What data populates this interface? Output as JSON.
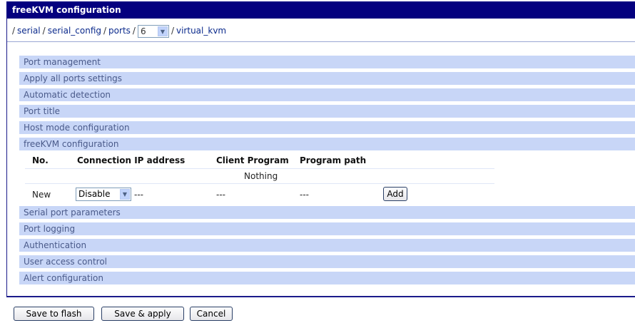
{
  "window": {
    "title": "freeKVM configuration"
  },
  "breadcrumb": {
    "lead_sep": "/",
    "items": [
      "serial",
      "serial_config",
      "ports"
    ],
    "seps": [
      "/",
      "/",
      "/",
      "/"
    ],
    "port_select_value": "6",
    "last": "virtual_kvm"
  },
  "sections_top": [
    "Port management",
    "Apply all ports settings",
    "Automatic detection",
    "Port title",
    "Host mode configuration",
    "freeKVM configuration"
  ],
  "kvm_table": {
    "headers": [
      "No.",
      "Connection IP address",
      "Client Program",
      "Program path"
    ],
    "empty_text": "Nothing",
    "new_row": {
      "no": "New",
      "select_value": "Disable",
      "ip": "---",
      "client": "---",
      "path": "---",
      "add_label": "Add"
    }
  },
  "sections_bottom": [
    "Serial port parameters",
    "Port logging",
    "Authentication",
    "User access control",
    "Alert configuration"
  ],
  "footer": {
    "save_flash": "Save to flash",
    "save_apply": "Save & apply",
    "cancel": "Cancel"
  },
  "colors": {
    "titlebar": "#04007f",
    "section_bar": "#c8d6f7",
    "link": "#0b2a8c"
  },
  "icons": {
    "select_arrow": "chevron-down-icon"
  }
}
